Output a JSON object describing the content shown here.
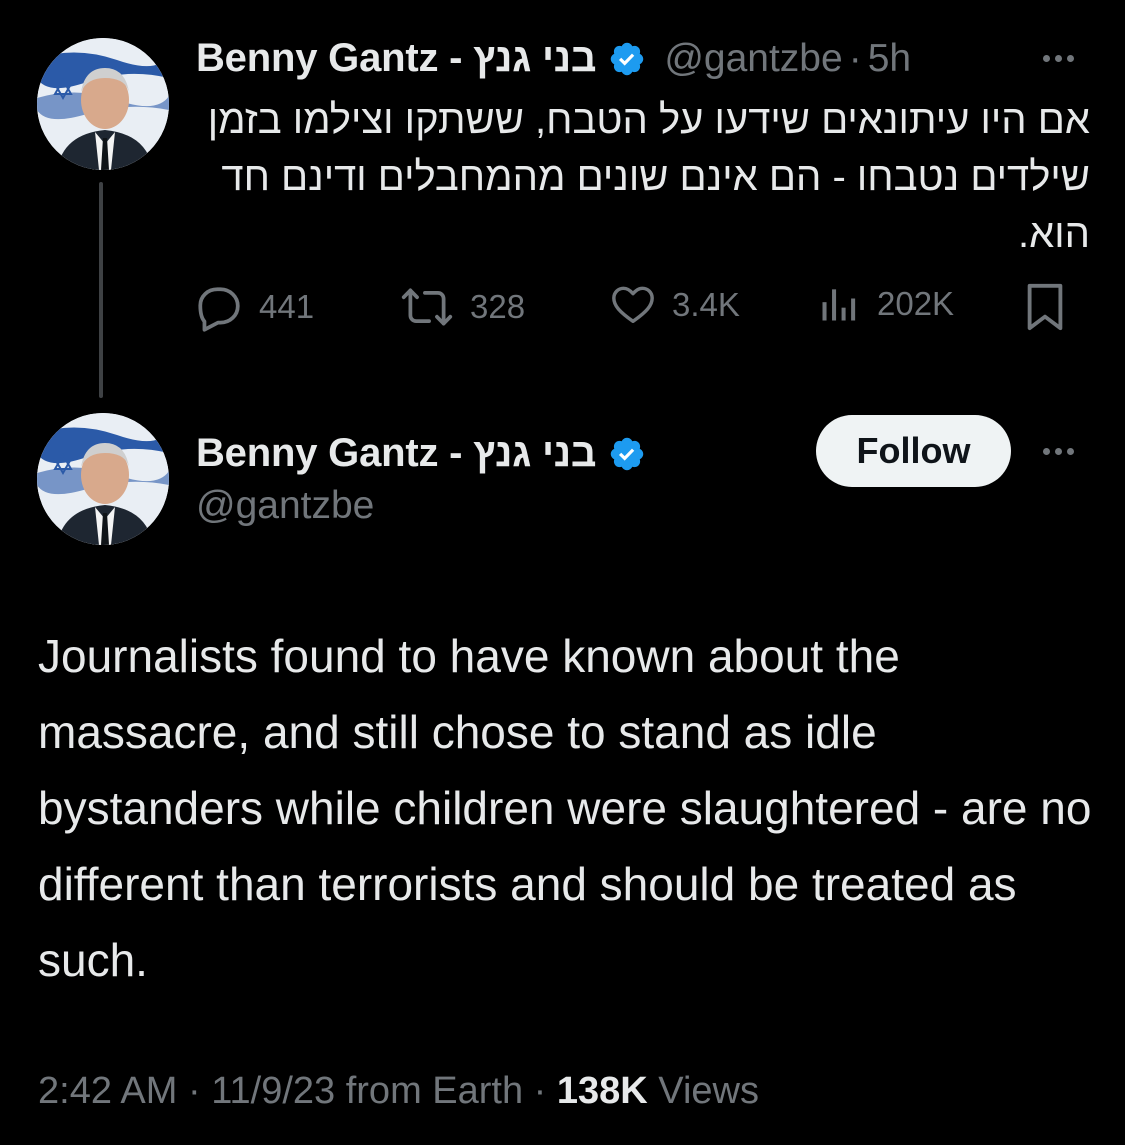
{
  "parent_tweet": {
    "display_name": "Benny Gantz - בני גנץ",
    "handle": "@gantzbe",
    "separator": "·",
    "age": "5h",
    "text": "אם היו עיתונאים שידעו על הטבח, ששתקו וצילמו בזמן שילדים נטבחו - הם אינם שונים מהמחבלים ודינם חד הוא.",
    "replies": "441",
    "reposts": "328",
    "likes": "3.4K",
    "views": "202K"
  },
  "main_tweet": {
    "display_name": "Benny Gantz - בני גנץ",
    "handle": "@gantzbe",
    "follow_label": "Follow",
    "text": "Journalists found to have known about the massacre, and still chose to stand as idle bystanders while children were slaughtered - are no different than terrorists and should be treated as such.",
    "time": "2:42 AM",
    "date": "11/9/23 from Earth",
    "separator": "·",
    "views_count": "138K",
    "views_label": "Views"
  },
  "icons": {
    "verified": "verified-badge-icon",
    "more": "more-horizontal-icon",
    "reply": "reply-icon",
    "repost": "repost-icon",
    "like": "heart-icon",
    "views": "analytics-icon",
    "bookmark": "bookmark-icon"
  },
  "colors": {
    "background": "#000000",
    "primary_text": "#e7e9ea",
    "secondary_text": "#71767b",
    "verified_blue": "#1d9bf0",
    "follow_bg": "#eff3f4"
  }
}
